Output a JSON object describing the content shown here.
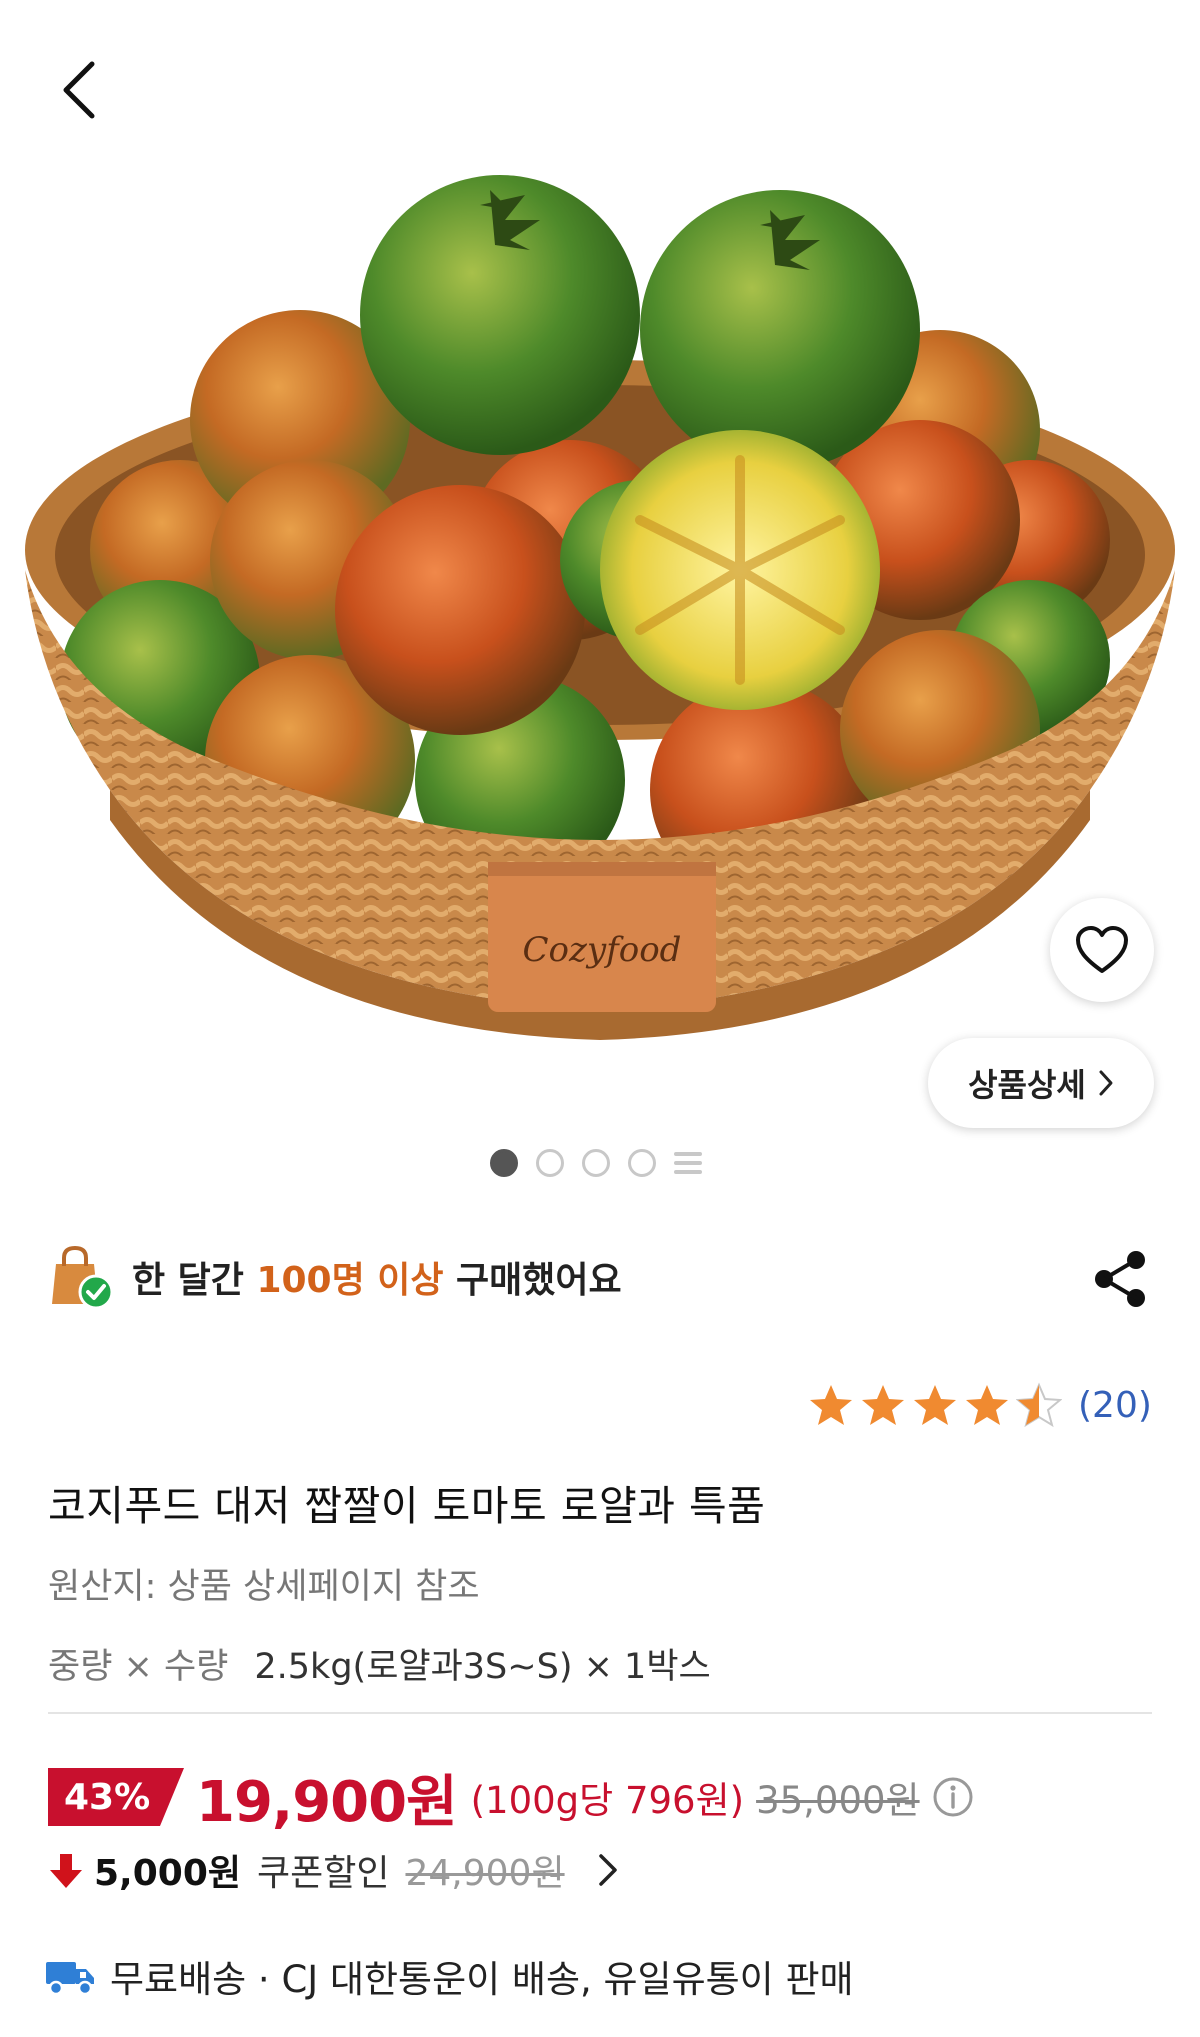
{
  "header": {
    "back_icon": "chevron-left-icon"
  },
  "hero": {
    "basket_label": "Cozyfood",
    "detail_button_label": "상품상세",
    "page_indicator": {
      "total_pages": 4,
      "current_page": 1
    }
  },
  "purchase_info": {
    "prefix": "한 달간",
    "highlight": "100명 이상",
    "suffix": "구매했어요",
    "highlight_color": "#d2621a"
  },
  "rating": {
    "score": 4.5,
    "max": 5,
    "count_label": "(20)"
  },
  "product": {
    "title": "코지푸드 대저 짭짤이 토마토 로얄과 특품",
    "origin": "원산지: 상품 상세페이지 참조",
    "weight_label": "중량 × 수량",
    "weight_value": "2.5kg(로얄과3S~S) × 1박스"
  },
  "price": {
    "discount_badge": "43%",
    "sale_price": "19,900원",
    "unit_price": "(100g당 796원)",
    "original_price": "35,000원",
    "accent_color": "#c8102e"
  },
  "coupon": {
    "amount": "5,000원",
    "label": "쿠폰할인",
    "price": "24,900원"
  },
  "shipping": {
    "text": "무료배송 · CJ 대한통운이 배송, 유일유통이 판매"
  }
}
